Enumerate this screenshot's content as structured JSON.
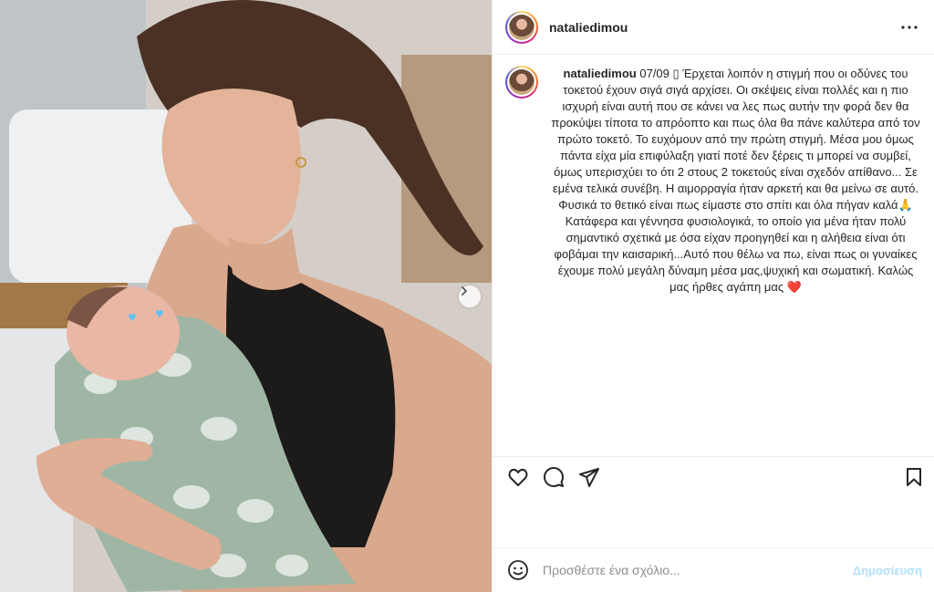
{
  "post": {
    "username": "nataliedimou",
    "more_icon": "more-horizontal-icon"
  },
  "caption": {
    "username": "nataliedimou",
    "date": "07/09",
    "glyph": "▯",
    "text": "Έρχεται λοιπόν η στιγμή που οι οδύνες του τοκετού έχουν σιγά σιγά αρχίσει. Οι σκέψεις είναι πολλές και η πιο ισχυρή είναι αυτή που σε κάνει να λες πως αυτήν την φορά δεν θα προκύψει τίποτα το απρόοπτο και πως όλα θα πάνε καλύτερα από τον πρώτο τοκετό. Το ευχόμουν από την πρώτη στιγμή. Μέσα μου όμως πάντα είχα μία επιφύλαξη γιατί ποτέ δεν ξέρεις τι μπορεί να συμβεί, όμως υπερισχύει το ότι 2 στους 2 τοκετούς είναι σχεδόν απίθανο... Σε εμένα τελικά συνέβη. Η αιμορραγία ήταν αρκετή και θα μείνω σε αυτό. Φυσικά το θετικό είναι πως είμαστε στο σπίτι και όλα πήγαν καλά🙏 Κατάφερα και γέννησα φυσιολογικά, το οποίο για μένα ήταν πολύ σημαντικό σχετικά με όσα είχαν προηγηθεί και η αλήθεια είναι ότι φοβάμαι την καισαρική...Αυτό που θέλω να πω, είναι πως οι γυναίκες έχουμε πολύ μεγάλη δύναμη μέσα μας,ψυχική και σωματική. Καλώς μας ήρθες αγάπη μας",
    "end_emoji": "❤️"
  },
  "actions": {
    "like_icon": "heart-icon",
    "comment_icon": "comment-icon",
    "share_icon": "send-icon",
    "save_icon": "bookmark-icon"
  },
  "comment_box": {
    "emoji_icon": "emoji-icon",
    "placeholder": "Προσθέστε ένα σχόλιο...",
    "post_label": "Δημοσίευση",
    "post_color": "#b2dffc"
  },
  "media": {
    "next_icon": "chevron-right-icon"
  }
}
